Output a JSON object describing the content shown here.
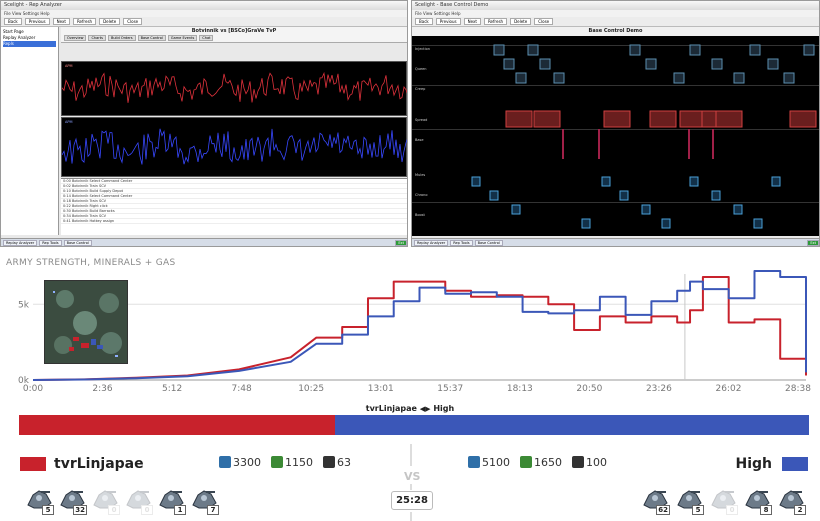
{
  "left_window": {
    "title": "Scelight - Rep Analyzer",
    "menu": "File  View  Settings  Help",
    "toolbar": [
      "Back",
      "Previous",
      "Next",
      "Refresh",
      "Delete",
      "Close"
    ],
    "tree": [
      "Start Page",
      "Replay Analyzer",
      "Repls"
    ],
    "replay_title": "Botvinnik vs [BSCo]GraVe  TvP",
    "subtabs": [
      "Overview",
      "Charts",
      "Build Orders",
      "Base Control",
      "Game Events",
      "Chat"
    ],
    "chart_label_top": "APM",
    "chart_label_bottom": "APM",
    "events": [
      "0:00  Botvinnik   Select Command Center",
      "0:02  Botvinnik   Train SCV",
      "0:10  Botvinnik   Build Supply Depot",
      "0:14  Botvinnik   Select Command Center",
      "0:18  Botvinnik   Train SCV",
      "0:22  Botvinnik   Right click",
      "0:30  Botvinnik   Build Barracks",
      "0:34  Botvinnik   Train SCV",
      "0:41  Botvinnik   Hotkey assign"
    ],
    "taskbar": [
      "Replay Analyzer",
      "Rep Tools",
      "Base Control",
      "Ext"
    ]
  },
  "right_window": {
    "title": "Scelight - Base Control Demo",
    "menu": "File  View  Settings  Help",
    "toolbar": [
      "Back",
      "Previous",
      "Next",
      "Refresh",
      "Delete",
      "Close"
    ],
    "panel_title": "Base Control Demo",
    "lanes": [
      "Injection",
      "Queen",
      "Creep",
      "Spread",
      "Base",
      "Mules",
      "Chrono",
      "Boost"
    ],
    "taskbar": [
      "Replay Analyzer",
      "Rep Tools",
      "Base Control",
      "Ext"
    ]
  },
  "strength": {
    "title": "ARMY STRENGTH, MINERALS + GAS",
    "colors": {
      "red": "#c8222c",
      "blue": "#3b57b8"
    }
  },
  "chart_data": {
    "type": "line",
    "title": "ARMY STRENGTH, MINERALS + GAS",
    "x_ticks": [
      "0:00",
      "2:36",
      "5:12",
      "7:48",
      "10:25",
      "13:01",
      "15:37",
      "18:13",
      "20:50",
      "23:26",
      "26:02",
      "28:38"
    ],
    "y_ticks": [
      "0k",
      "5k"
    ],
    "ylim": [
      0,
      7000
    ],
    "x_minutes": [
      0,
      2,
      4,
      6,
      8,
      10,
      11,
      12,
      13,
      14,
      15,
      16,
      17,
      18,
      19,
      20,
      21,
      22,
      23,
      24,
      25,
      25.5,
      26,
      27,
      28,
      29,
      30
    ],
    "series": [
      {
        "color": "#c8222c",
        "values": [
          0,
          40,
          150,
          300,
          700,
          1500,
          2800,
          3500,
          5400,
          6500,
          6500,
          5900,
          5500,
          5600,
          5500,
          5000,
          3300,
          4200,
          3800,
          4200,
          3800,
          4600,
          6800,
          3800,
          4000,
          1400,
          300
        ]
      },
      {
        "color": "#3b57b8",
        "values": [
          0,
          30,
          120,
          250,
          600,
          1200,
          2400,
          3000,
          4200,
          5200,
          6100,
          5700,
          5800,
          5500,
          4500,
          4400,
          4600,
          5500,
          4300,
          5200,
          5900,
          6500,
          6000,
          5400,
          7200,
          6800,
          500
        ]
      }
    ]
  },
  "matchup": {
    "label_left": "tvrLinjapae",
    "arrow": "◀▶",
    "label_right": "High"
  },
  "balance_red_percent": 40,
  "player_left": {
    "name": "tvrLinjapae",
    "color": "#c8222c",
    "minerals": "3300",
    "gas": "1150",
    "supply": "63",
    "units": [
      {
        "icon": "siege-tank-icon",
        "count": "5",
        "faded": false
      },
      {
        "icon": "viking-icon",
        "count": "32",
        "faded": false
      },
      {
        "icon": "hellion-icon",
        "count": "0",
        "faded": true
      },
      {
        "icon": "marine-icon",
        "count": "0",
        "faded": true
      },
      {
        "icon": "thor-icon",
        "count": "1",
        "faded": false
      },
      {
        "icon": "widow-mine-icon",
        "count": "7",
        "faded": false
      }
    ]
  },
  "player_right": {
    "name": "High",
    "color": "#3b57b8",
    "minerals": "5100",
    "gas": "1650",
    "supply": "100",
    "units": [
      {
        "icon": "viking-icon",
        "count": "62",
        "faded": false
      },
      {
        "icon": "battlecruiser-icon",
        "count": "5",
        "faded": false
      },
      {
        "icon": "hellion-icon",
        "count": "0",
        "faded": true
      },
      {
        "icon": "siege-tank-icon",
        "count": "8",
        "faded": false
      },
      {
        "icon": "thor-icon",
        "count": "2",
        "faded": false
      }
    ]
  },
  "vs_label": "VS",
  "game_time": "25:28"
}
